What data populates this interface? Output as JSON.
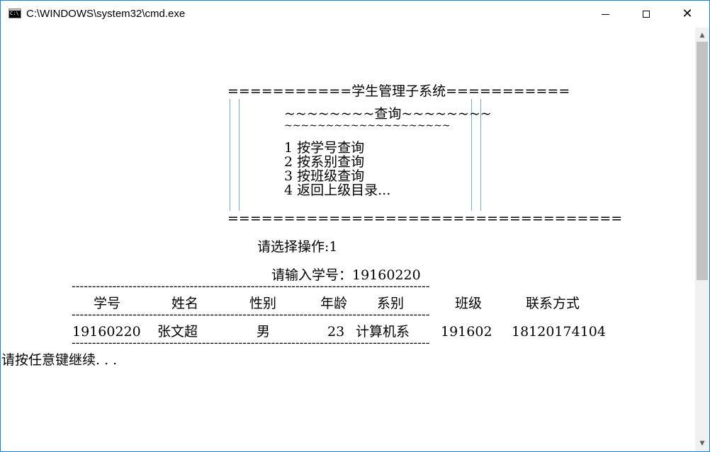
{
  "window": {
    "title": "C:\\WINDOWS\\system32\\cmd.exe",
    "minimize_icon": "minimize-icon",
    "maximize_icon": "maximize-icon",
    "close_icon": "close-icon",
    "close_glyph": "✕"
  },
  "menu": {
    "top_border": "===========学生管理子系统===========",
    "title_deco_top": "~~~~~~~~查询~~~~~~~~",
    "title_deco_bottom": "~~~~~~~~~~~~~~~~~~~~",
    "items": [
      "1 按学号查询",
      "2 按系别查询",
      "3 按班级查询",
      "4 返回上级目录..."
    ],
    "bottom_border": "==================================="
  },
  "prompts": {
    "select_op": "请选择操作:1",
    "input_id": "请输入学号：19160220",
    "continue": "请按任意键继续. . ."
  },
  "table": {
    "rule": "----------------------------------------------------------------------------------------",
    "headers": [
      "学号",
      "姓名",
      "性别",
      "年龄",
      "系别",
      "班级",
      "联系方式"
    ],
    "rows": [
      [
        "19160220",
        "张文超",
        "男",
        "23",
        "计算机系",
        "191602",
        "18120174104"
      ]
    ]
  },
  "scrollbar": {
    "up_glyph": "▲",
    "down_glyph": "▼"
  }
}
